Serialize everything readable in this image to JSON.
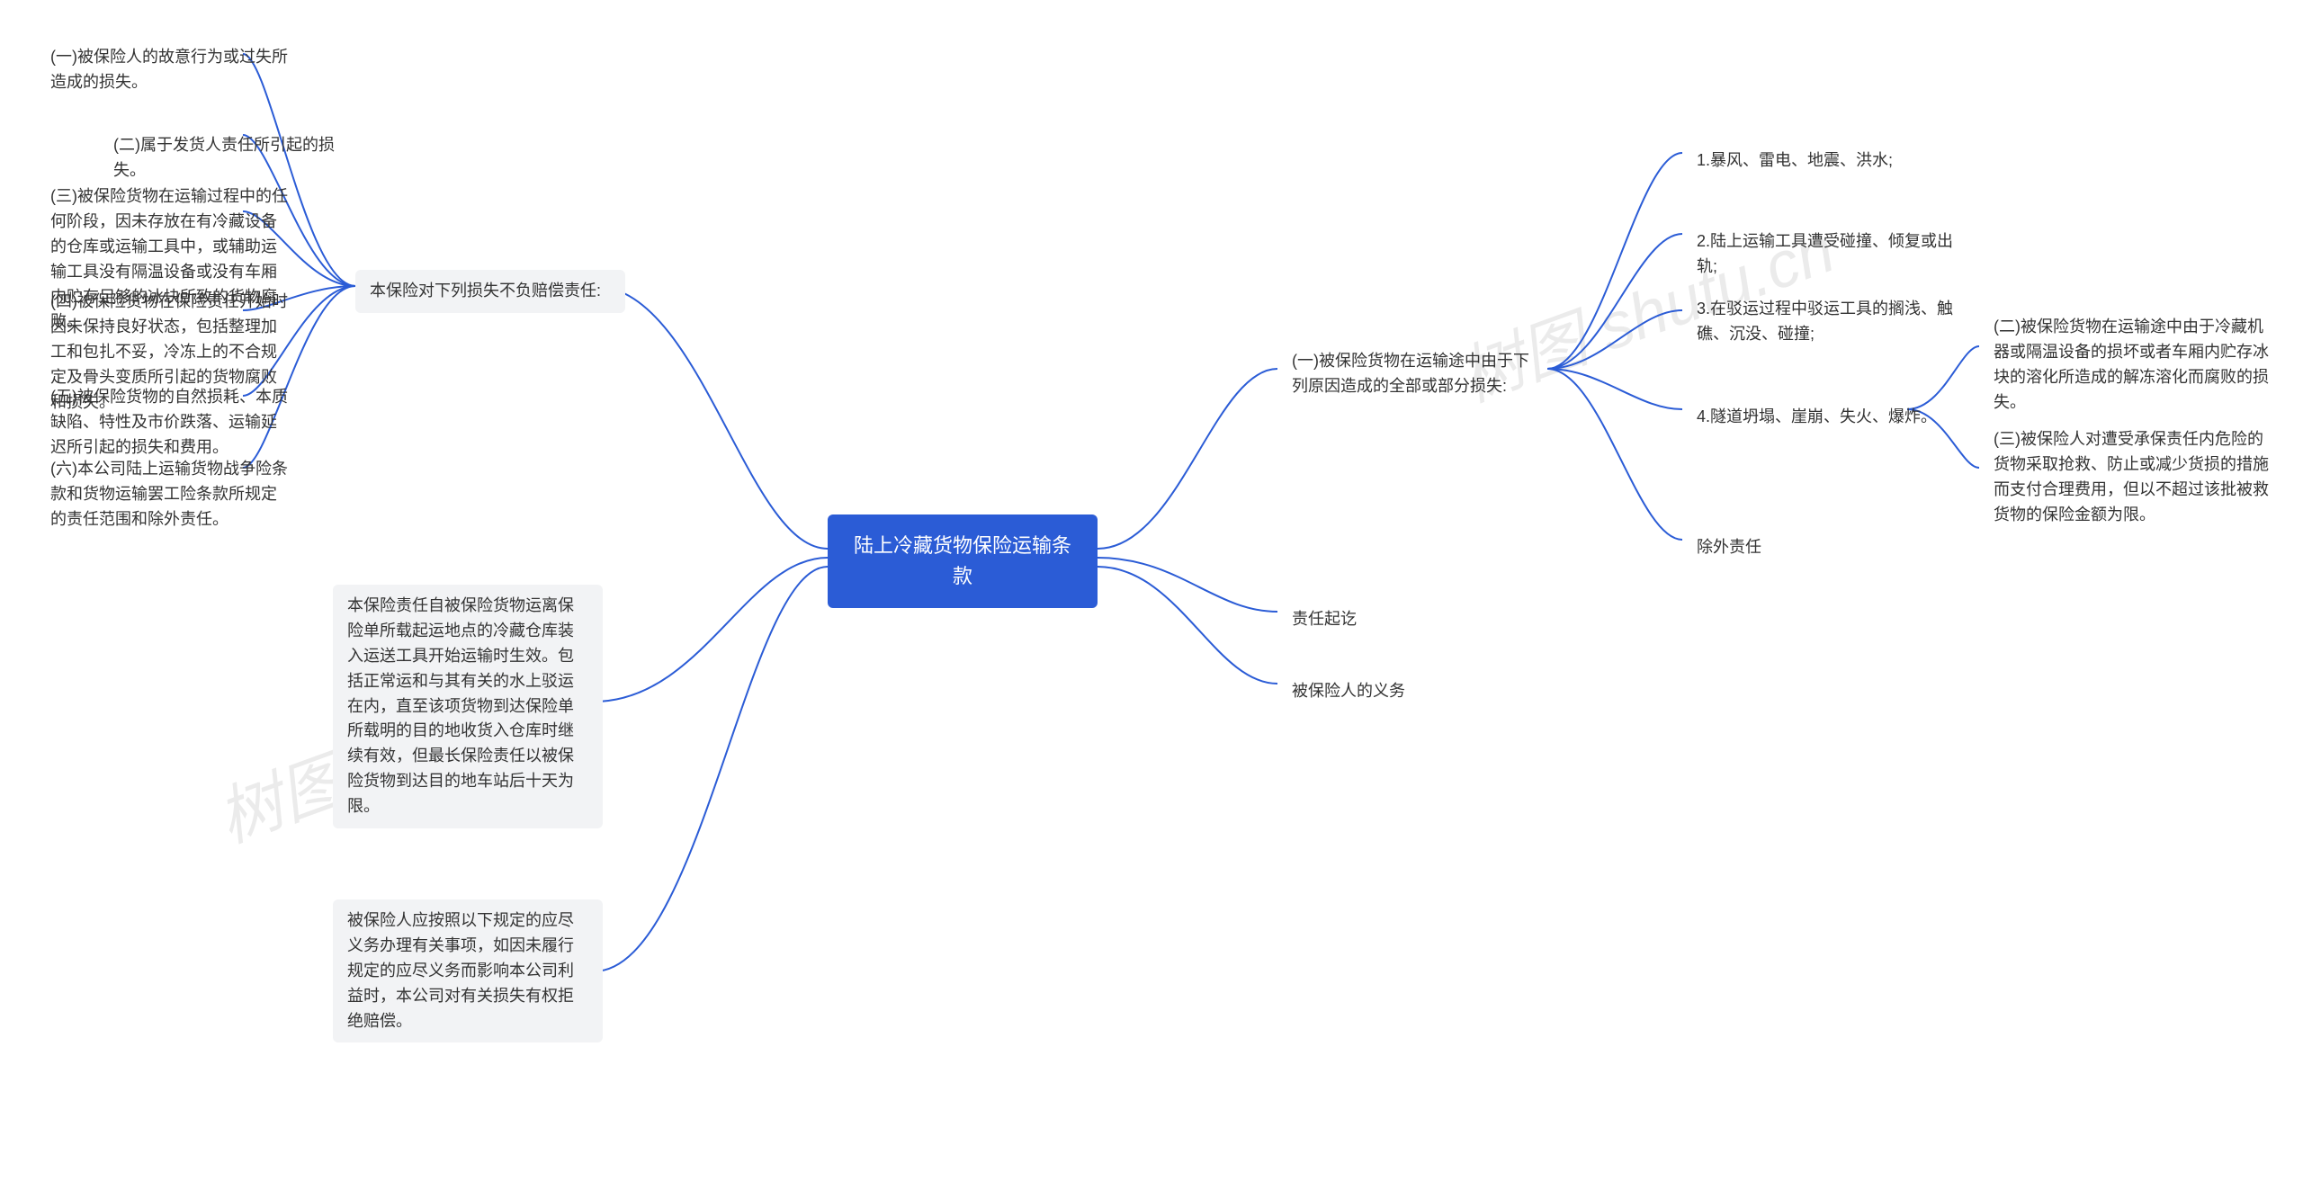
{
  "chart_data": {
    "type": "mindmap",
    "root": "陆上冷藏货物保险运输条款",
    "branches_right": [
      {
        "label": "(一)被保险货物在运输途中由于下列原因造成的全部或部分损失:",
        "children": [
          {
            "label": "1.暴风、雷电、地震、洪水;"
          },
          {
            "label": "2.陆上运输工具遭受碰撞、倾复或出轨;"
          },
          {
            "label": "3.在驳运过程中驳运工具的搁浅、触礁、沉没、碰撞;"
          },
          {
            "label": "4.隧道坍塌、崖崩、失火、爆炸。",
            "children": [
              {
                "label": "(二)被保险货物在运输途中由于冷藏机器或隔温设备的损坏或者车厢内贮存冰块的溶化所造成的解冻溶化而腐败的损失。"
              },
              {
                "label": "(三)被保险人对遭受承保责任内危险的货物采取抢救、防止或减少货损的措施而支付合理费用，但以不超过该批被救货物的保险金额为限。"
              }
            ]
          },
          {
            "label": "除外责任"
          }
        ]
      },
      {
        "label": "责任起讫"
      },
      {
        "label": "被保险人的义务"
      }
    ],
    "branches_left": [
      {
        "label": "本保险对下列损失不负赔偿责任:",
        "children": [
          {
            "label": "(一)被保险人的故意行为或过失所造成的损失。"
          },
          {
            "label": "(二)属于发货人责任所引起的损失。"
          },
          {
            "label": "(三)被保险货物在运输过程中的任何阶段，因未存放在有冷藏设备的仓库或运输工具中，或辅助运输工具没有隔温设备或没有车厢内贮存足够的冰块所致的货物腐败。"
          },
          {
            "label": "(四)被保险货物在保险责任开始时因未保持良好状态，包括整理加工和包扎不妥，冷冻上的不合规定及骨头变质所引起的货物腐败和损失。"
          },
          {
            "label": "(五)被保险货物的自然损耗、本质缺陷、特性及市价跌落、运输延迟所引起的损失和费用。"
          },
          {
            "label": "(六)本公司陆上运输货物战争险条款和货物运输罢工险条款所规定的责任范围和除外责任。"
          }
        ]
      },
      {
        "label": "本保险责任自被保险货物运离保险单所载起运地点的冷藏仓库装入运送工具开始运输时生效。包括正常运和与其有关的水上驳运在内，直至该项货物到达保险单所载明的目的地收货入仓库时继续有效，但最长保险责任以被保险货物到达目的地车站后十天为限。"
      },
      {
        "label": "被保险人应按照以下规定的应尽义务办理有关事项，如因未履行规定的应尽义务而影响本公司利益时，本公司对有关损失有权拒绝赔偿。"
      }
    ]
  },
  "watermark": "树图 shutu.cn",
  "root": "陆上冷藏货物保险运输条款",
  "left": {
    "exclusions_header": "本保险对下列损失不负赔偿责任:",
    "ex1": "(一)被保险人的故意行为或过失所造成的损失。",
    "ex2": "(二)属于发货人责任所引起的损失。",
    "ex3": "(三)被保险货物在运输过程中的任何阶段，因未存放在有冷藏设备的仓库或运输工具中，或辅助运输工具没有隔温设备或没有车厢内贮存足够的冰块所致的货物腐败。",
    "ex4": "(四)被保险货物在保险责任开始时因未保持良好状态，包括整理加工和包扎不妥，冷冻上的不合规定及骨头变质所引起的货物腐败和损失。",
    "ex5": "(五)被保险货物的自然损耗、本质缺陷、特性及市价跌落、运输延迟所引起的损失和费用。",
    "ex6": "(六)本公司陆上运输货物战争险条款和货物运输罢工险条款所规定的责任范围和除外责任。",
    "liability_period": "本保险责任自被保险货物运离保险单所载起运地点的冷藏仓库装入运送工具开始运输时生效。包括正常运和与其有关的水上驳运在内，直至该项货物到达保险单所载明的目的地收货入仓库时继续有效，但最长保险责任以被保险货物到达目的地车站后十天为限。",
    "duty": "被保险人应按照以下规定的应尽义务办理有关事项，如因未履行规定的应尽义务而影响本公司利益时，本公司对有关损失有权拒绝赔偿。"
  },
  "right": {
    "covered_header": "(一)被保险货物在运输途中由于下列原因造成的全部或部分损失:",
    "c1": "1.暴风、雷电、地震、洪水;",
    "c2": "2.陆上运输工具遭受碰撞、倾复或出轨;",
    "c3": "3.在驳运过程中驳运工具的搁浅、触礁、沉没、碰撞;",
    "c4": "4.隧道坍塌、崖崩、失火、爆炸。",
    "c4a": "(二)被保险货物在运输途中由于冷藏机器或隔温设备的损坏或者车厢内贮存冰块的溶化所造成的解冻溶化而腐败的损失。",
    "c4b": "(三)被保险人对遭受承保责任内危险的货物采取抢救、防止或减少货损的措施而支付合理费用，但以不超过该批被救货物的保险金额为限。",
    "except": "除外责任",
    "period_label": "责任起讫",
    "duty_label": "被保险人的义务"
  }
}
